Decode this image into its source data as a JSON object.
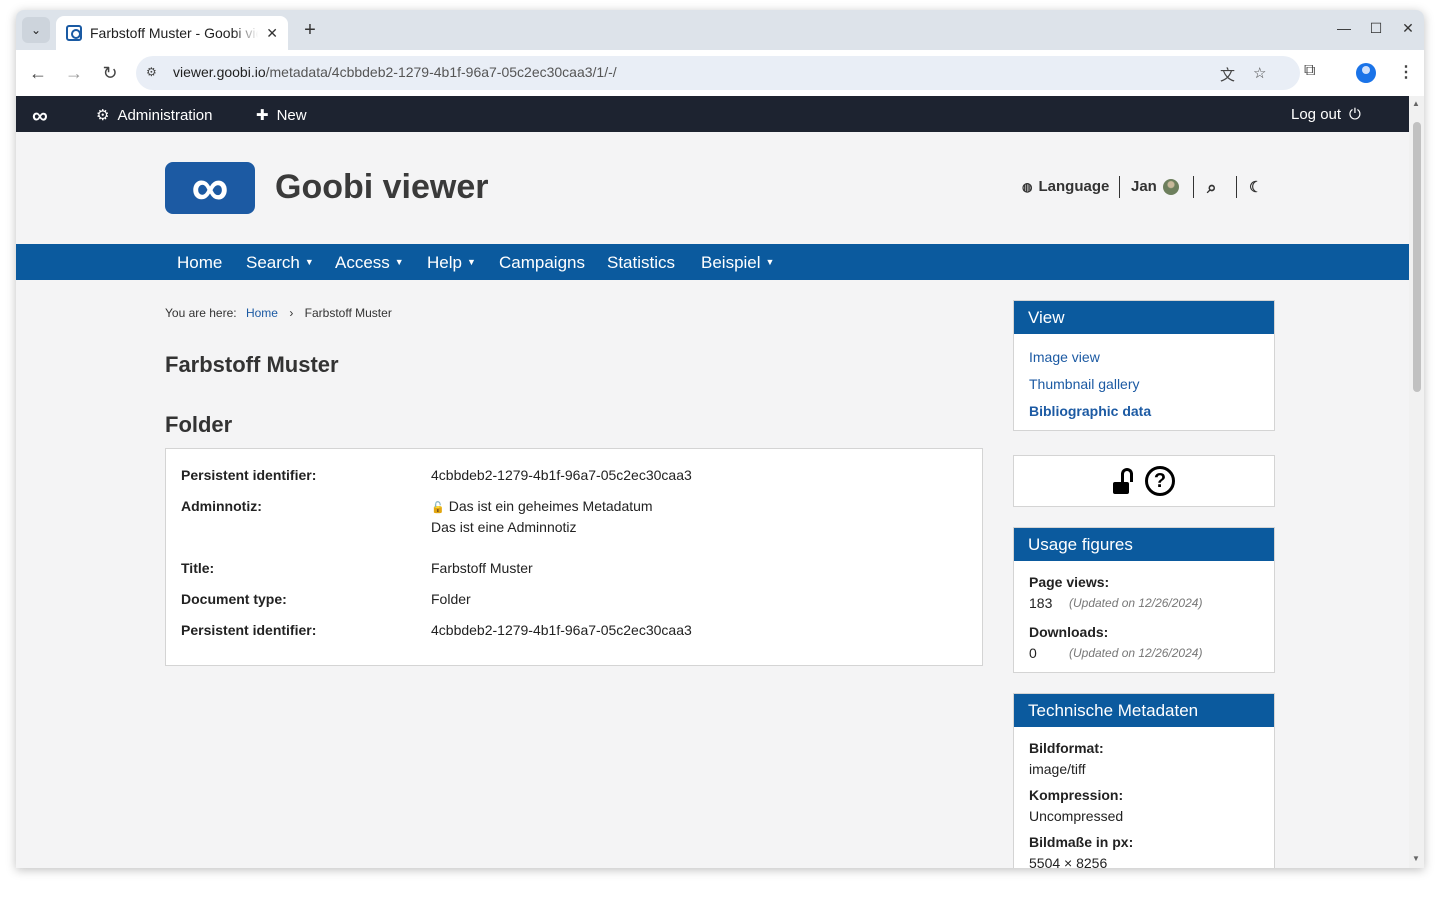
{
  "browser": {
    "tab_title": "Farbstoff Muster - Goobi viewer",
    "url_host": "viewer.goobi.io",
    "url_path": "/metadata/4cbbdeb2-1279-4b1f-96a7-05c2ec30caa3/1/-/"
  },
  "adminbar": {
    "logo": "∞",
    "administration_label": "Administration",
    "new_label": "New",
    "logout_label": "Log out"
  },
  "header": {
    "brand": "Goobi viewer",
    "logo_symbol": "∞",
    "language_label": "Language",
    "user_name": "Jan"
  },
  "mainnav": {
    "items": [
      "Home",
      "Search",
      "Access",
      "Help",
      "Campaigns",
      "Statistics",
      "Beispiel"
    ]
  },
  "breadcrumb": {
    "prefix": "You are here:",
    "home": "Home",
    "current": "Farbstoff Muster"
  },
  "page": {
    "title": "Farbstoff Muster",
    "section_title": "Folder"
  },
  "metadata": {
    "rows": [
      {
        "label": "Persistent identifier:",
        "value": "4cbbdeb2-1279-4b1f-96a7-05c2ec30caa3"
      },
      {
        "label": "Adminnotiz:",
        "value": "Das ist ein geheimes Metadatum",
        "value2": "Das ist eine Adminnotiz"
      },
      {
        "label": "Title:",
        "value": "Farbstoff Muster"
      },
      {
        "label": "Document type:",
        "value": "Folder"
      },
      {
        "label": "Persistent identifier:",
        "value": "4cbbdeb2-1279-4b1f-96a7-05c2ec30caa3"
      }
    ]
  },
  "sidebar": {
    "view": {
      "title": "View",
      "links": [
        "Image view",
        "Thumbnail gallery",
        "Bibliographic data"
      ]
    },
    "usage": {
      "title": "Usage figures",
      "page_views_label": "Page views:",
      "page_views_value": "183",
      "page_views_note": "(Updated on 12/26/2024)",
      "downloads_label": "Downloads:",
      "downloads_value": "0",
      "downloads_note": "(Updated on 12/26/2024)"
    },
    "technical": {
      "title": "Technische Metadaten",
      "items": [
        {
          "label": "Bildformat:",
          "value": "image/tiff"
        },
        {
          "label": "Kompression:",
          "value": "Uncompressed"
        },
        {
          "label": "Bildmaße in px:",
          "value": "5504 × 8256"
        }
      ]
    }
  },
  "colors": {
    "primary": "#0b5a9e",
    "adminbar": "#1d2330",
    "link": "#1c5aa3"
  }
}
